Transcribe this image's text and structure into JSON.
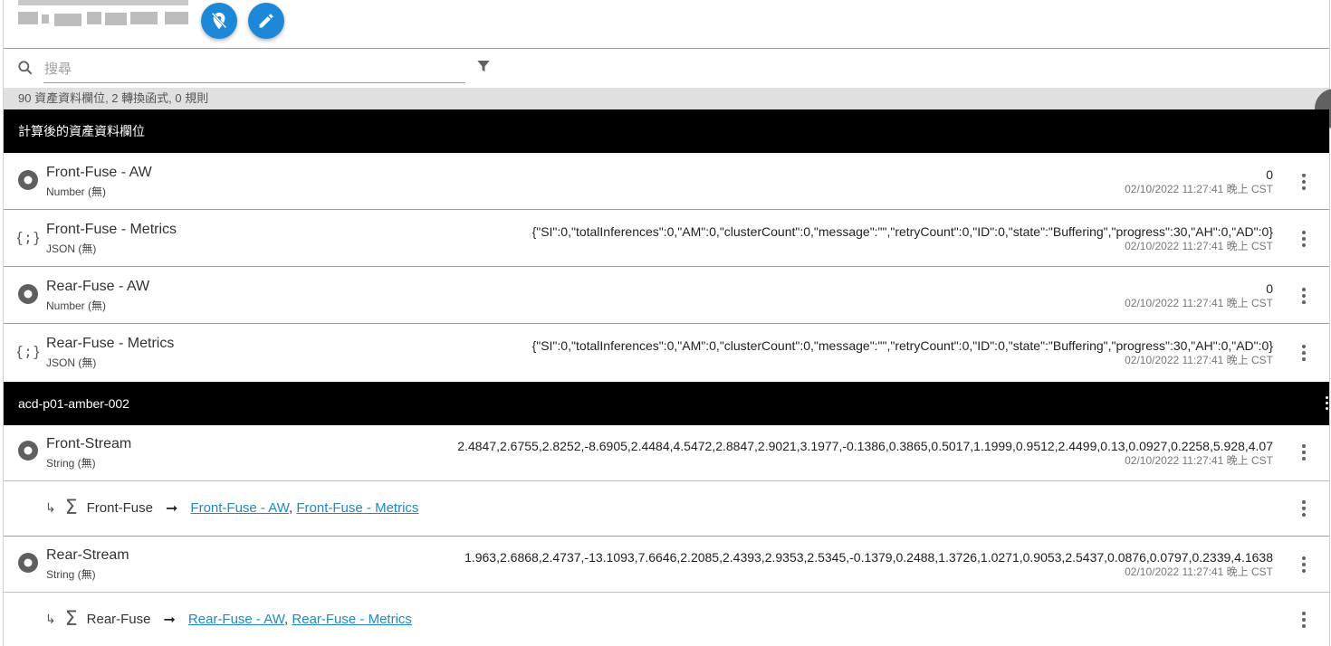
{
  "header": {
    "edit_label": "Edit",
    "pin_label": "Unpin"
  },
  "search": {
    "placeholder": "搜尋",
    "value": ""
  },
  "summary": "90 資產資料欄位, 2 轉換函式, 0 規則",
  "sections": [
    {
      "title": "計算後的資產資料欄位",
      "rows": [
        {
          "icon": "circle-number-icon",
          "name": "Front-Fuse - AW",
          "type": "Number (無)",
          "value": "0",
          "time": "02/10/2022 11:27:41 晚上 CST"
        },
        {
          "icon": "json-braces-icon",
          "name": "Front-Fuse - Metrics",
          "type": "JSON (無)",
          "value": "{\"SI\":0,\"totalInferences\":0,\"AM\":0,\"clusterCount\":0,\"message\":\"\",\"retryCount\":0,\"ID\":0,\"state\":\"Buffering\",\"progress\":30,\"AH\":0,\"AD\":0}",
          "time": "02/10/2022 11:27:41 晚上 CST"
        },
        {
          "icon": "circle-number-icon",
          "name": "Rear-Fuse - AW",
          "type": "Number (無)",
          "value": "0",
          "time": "02/10/2022 11:27:41 晚上 CST"
        },
        {
          "icon": "json-braces-icon",
          "name": "Rear-Fuse - Metrics",
          "type": "JSON (無)",
          "value": "{\"SI\":0,\"totalInferences\":0,\"AM\":0,\"clusterCount\":0,\"message\":\"\",\"retryCount\":0,\"ID\":0,\"state\":\"Buffering\",\"progress\":30,\"AH\":0,\"AD\":0}",
          "time": "02/10/2022 11:27:41 晚上 CST"
        }
      ]
    },
    {
      "title": "acd-p01-amber-002",
      "rows": [
        {
          "icon": "circle-number-icon",
          "name": "Front-Stream",
          "type": "String (無)",
          "value": "2.4847,2.6755,2.8252,-8.6905,2.4484,4.5472,2.8847,2.9021,3.1977,-0.1386,0.3865,0.5017,1.1999,0.9512,2.4499,0.13,0.0927,0.2258,5.928,4.07",
          "time": "02/10/2022 11:27:41 晚上 CST",
          "transform": {
            "arrow": "↳",
            "sigma": "Σ",
            "name": "Front-Fuse",
            "to": "➞",
            "outputs": [
              "Front-Fuse - AW",
              "Front-Fuse - Metrics"
            ],
            "sep": ","
          }
        },
        {
          "icon": "circle-number-icon",
          "name": "Rear-Stream",
          "type": "String (無)",
          "value": "1.963,2.6868,2.4737,-13.1093,7.6646,2.2085,2.4393,2.9353,2.5345,-0.1379,0.2488,1.3726,1.0271,0.9053,2.5437,0.0876,0.0797,0.2339,4.1638",
          "time": "02/10/2022 11:27:41 晚上 CST",
          "transform": {
            "arrow": "↳",
            "sigma": "Σ",
            "name": "Rear-Fuse",
            "to": "➞",
            "outputs": [
              "Rear-Fuse - AW",
              "Rear-Fuse - Metrics"
            ],
            "sep": ","
          }
        }
      ]
    }
  ]
}
